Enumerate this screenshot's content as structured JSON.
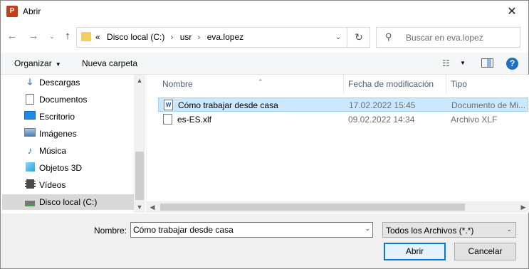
{
  "window": {
    "title": "Abrir",
    "app_icon_letter": "P"
  },
  "address_bar": {
    "crumbs": [
      "«",
      "Disco local (C:)",
      "usr",
      "eva.lopez"
    ]
  },
  "search": {
    "placeholder": "Buscar en eva.lopez"
  },
  "toolbar": {
    "organize_label": "Organizar",
    "new_folder_label": "Nueva carpeta",
    "help_label": "?"
  },
  "navigation": {
    "items": [
      {
        "label": "Descargas",
        "icon": "download-arrow-icon",
        "color": "#2b7cd3"
      },
      {
        "label": "Documentos",
        "icon": "document-icon",
        "color": "#6d6d6d"
      },
      {
        "label": "Escritorio",
        "icon": "desktop-icon",
        "color": "#1f8be8"
      },
      {
        "label": "Imágenes",
        "icon": "image-icon",
        "color": "#4a7fb5"
      },
      {
        "label": "Música",
        "icon": "music-note-icon",
        "color": "#2b7cd3"
      },
      {
        "label": "Objetos 3D",
        "icon": "cube-icon",
        "color": "#2aa3d9"
      },
      {
        "label": "Vídeos",
        "icon": "film-icon",
        "color": "#4a4a4a"
      },
      {
        "label": "Disco local (C:)",
        "icon": "drive-icon",
        "color": "#555555",
        "selected": true
      }
    ]
  },
  "file_list": {
    "columns": [
      "Nombre",
      "Fecha de modificación",
      "Tipo"
    ],
    "rows": [
      {
        "name": "Cómo trabajar desde casa",
        "date": "17.02.2022 15:45",
        "type": "Documento de Mi...",
        "icon_letter": "W",
        "selected": true
      },
      {
        "name": "es-ES.xlf",
        "date": "09.02.2022 14:34",
        "type": "Archivo XLF",
        "icon_letter": "",
        "selected": false
      }
    ]
  },
  "footer": {
    "name_label": "Nombre:",
    "name_value": "Cómo trabajar desde casa",
    "filter_value": "Todos los Archivos (*.*)",
    "open_label": "Abrir",
    "cancel_label": "Cancelar"
  },
  "colors": {
    "selection_bg": "#cce8ff",
    "accent": "#0078d7",
    "help_blue": "#1f6fc5"
  }
}
